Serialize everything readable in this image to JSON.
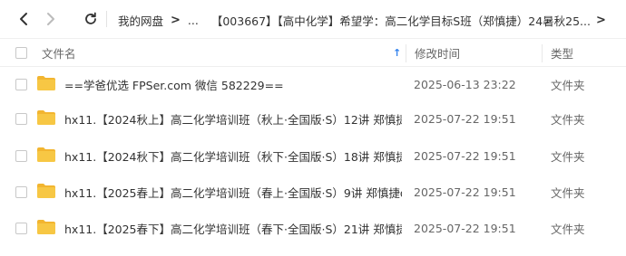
{
  "nav": {
    "back_icon": "chevron-left-icon",
    "forward_icon": "chevron-right-icon",
    "refresh_icon": "refresh-icon"
  },
  "breadcrumb": {
    "root": "我的网盘",
    "arrow1": ">",
    "ellipsis": "...",
    "current": "【003667】【高中化学】希望学：高二化学目标S班（郑慎捷）24暑秋25...",
    "more": ">"
  },
  "header": {
    "name_label": "文件名",
    "sort_icon": "↑",
    "modified_label": "修改时间",
    "type_label": "类型"
  },
  "files": [
    {
      "name": "==学爸优选 FPSer.com 微信 582229==",
      "modified": "2025-06-13 23:22",
      "type": "文件夹"
    },
    {
      "name": "hx11.【2024秋上】高二化学培训班（秋上·全国版·S）12讲 郑慎捷o",
      "modified": "2025-07-22 19:51",
      "type": "文件夹"
    },
    {
      "name": "hx11.【2024秋下】高二化学培训班（秋下·全国版·S）18讲 郑慎捷o",
      "modified": "2025-07-22 19:51",
      "type": "文件夹"
    },
    {
      "name": "hx11.【2025春上】高二化学培训班（春上·全国版·S）9讲 郑慎捷o",
      "modified": "2025-07-22 19:51",
      "type": "文件夹"
    },
    {
      "name": "hx11.【2025春下】高二化学培训班（春下·全国版·S）21讲 郑慎捷...",
      "modified": "2025-07-22 19:51",
      "type": "文件夹"
    }
  ],
  "colors": {
    "folder_body": "#f7c744",
    "folder_tab": "#f2b530",
    "accent": "#2f80ed"
  }
}
